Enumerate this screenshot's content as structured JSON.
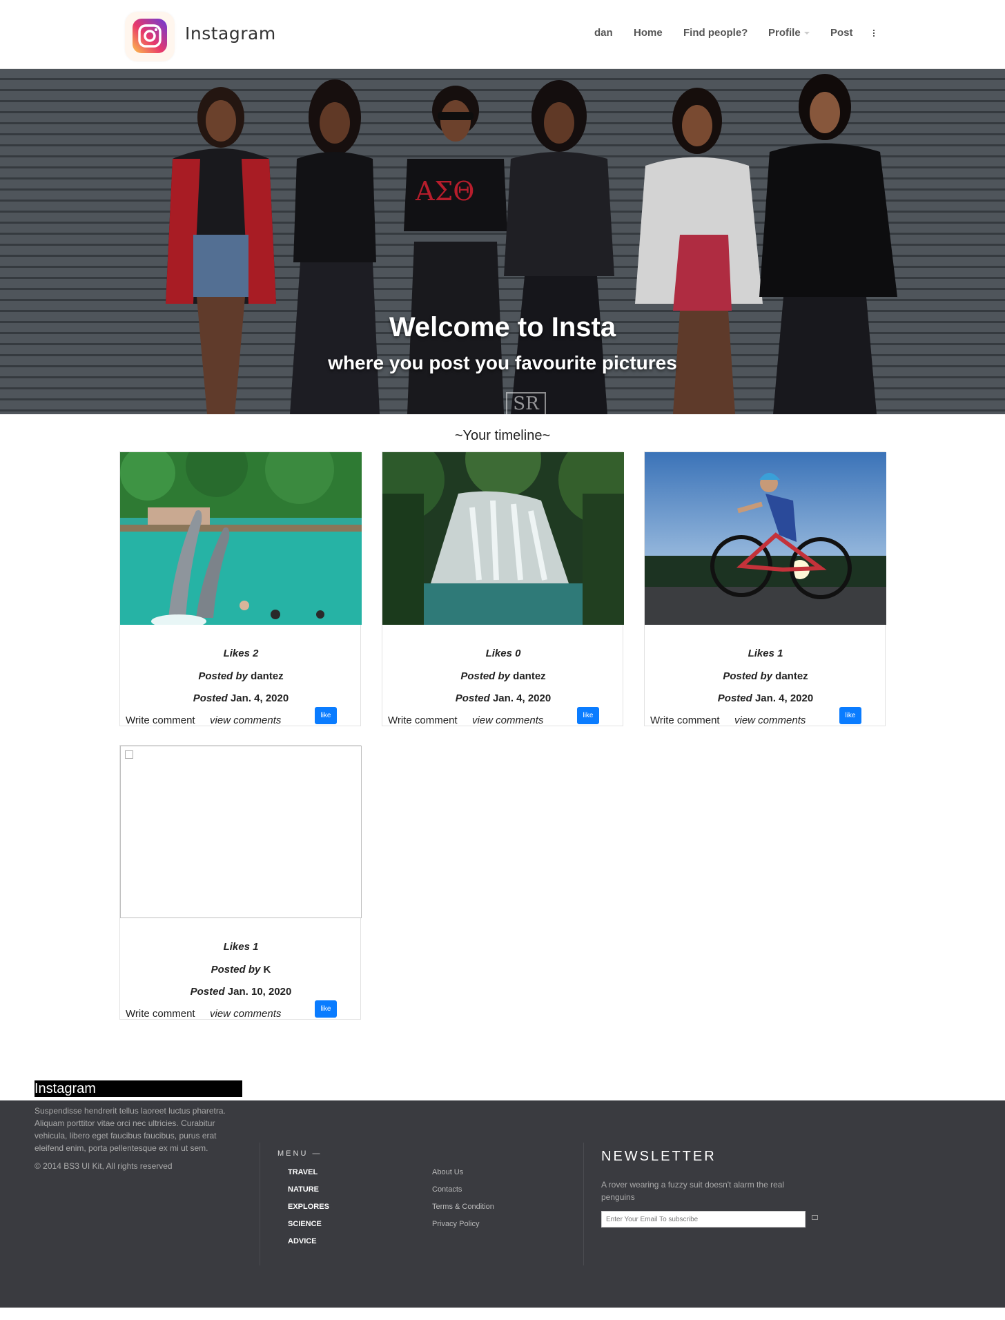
{
  "header": {
    "brand": "Instagram",
    "nav": {
      "user": "dan",
      "home": "Home",
      "find_people": "Find people?",
      "profile": "Profile",
      "post": "Post"
    }
  },
  "hero": {
    "title": "Welcome to Insta",
    "subtitle": "where you post you favourite pictures",
    "watermark": "SR"
  },
  "timeline": {
    "title": "~Your timeline~",
    "write_comment": "Write comment",
    "view_comments": "view comments",
    "like_label": "like",
    "posts": [
      {
        "likes": "Likes 2",
        "posted_by_label": "Posted by",
        "author": "dantez",
        "posted_label": "Posted",
        "date": "Jan. 4, 2020",
        "image": "dolphins"
      },
      {
        "likes": "Likes 0",
        "posted_by_label": "Posted by",
        "author": "dantez",
        "posted_label": "Posted",
        "date": "Jan. 4, 2020",
        "image": "waterfall"
      },
      {
        "likes": "Likes 1",
        "posted_by_label": "Posted by",
        "author": "dantez",
        "posted_label": "Posted",
        "date": "Jan. 4, 2020",
        "image": "cyclist"
      },
      {
        "likes": "Likes 1",
        "posted_by_label": "Posted by",
        "author": "K",
        "posted_label": "Posted",
        "date": "Jan. 10, 2020",
        "image": "broken-image"
      }
    ]
  },
  "footer": {
    "brand": "Instagram",
    "description": "Suspendisse hendrerit tellus laoreet luctus pharetra. Aliquam porttitor vitae orci nec ultricies. Curabitur vehicula, libero eget faucibus faucibus, purus erat eleifend enim, porta pellentesque ex mi ut sem.",
    "copyright": "© 2014 BS3 UI Kit, All rights reserved",
    "menu_title": "MENU —",
    "menu_items": [
      "TRAVEL",
      "NATURE",
      "EXPLORES",
      "SCIENCE",
      "ADVICE"
    ],
    "links": [
      "About Us",
      "Contacts",
      "Terms & Condition",
      "Privacy Policy"
    ],
    "newsletter": {
      "title": "NEWSLETTER",
      "description": "A rover wearing a fuzzy suit doesn't alarm the real penguins",
      "placeholder": "Enter Your Email To subscribe"
    }
  },
  "colors": {
    "like_button": "#0a7cff",
    "footer_background": "#3a3b40"
  }
}
